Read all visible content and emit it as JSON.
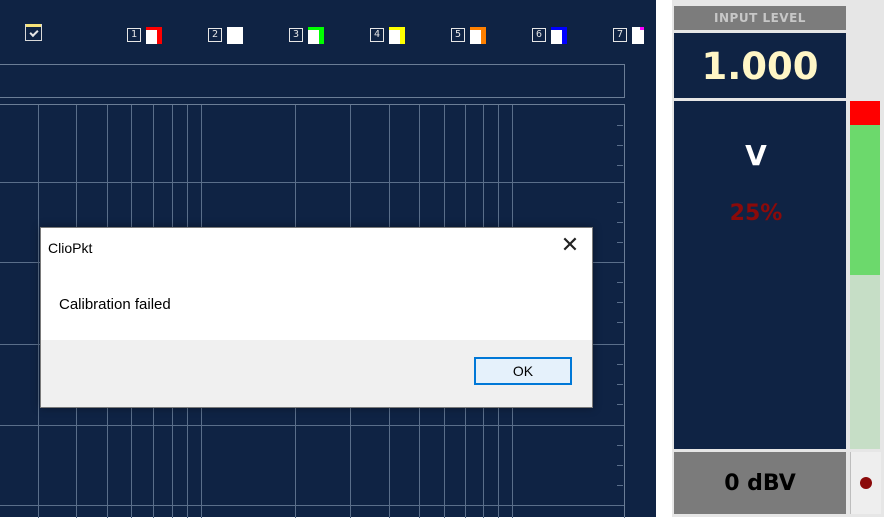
{
  "toolbar": {
    "channels": [
      {
        "number": "1",
        "color": "#ff0000"
      },
      {
        "number": "2",
        "color": "#ffffff"
      },
      {
        "number": "3",
        "color": "#00ff00"
      },
      {
        "number": "4",
        "color": "#ffff00"
      },
      {
        "number": "5",
        "color": "#ff8000"
      },
      {
        "number": "6",
        "color": "#0000ff"
      },
      {
        "number": "7",
        "color": "#ff00ff"
      }
    ]
  },
  "input_level": {
    "title": "INPUT LEVEL",
    "value": "1.000",
    "unit": "V",
    "percent": "25%",
    "range": "0 dBV",
    "meter_fill_fraction": 0.5
  },
  "dialog": {
    "title": "ClioPkt",
    "message": "Calibration failed",
    "ok_label": "OK",
    "close_glyph": "✕"
  },
  "colors": {
    "graph_bg": "#0f2344",
    "value_text": "#fff6c6",
    "percent_text": "#8b0a0a",
    "accent_blue": "#0078d7"
  }
}
